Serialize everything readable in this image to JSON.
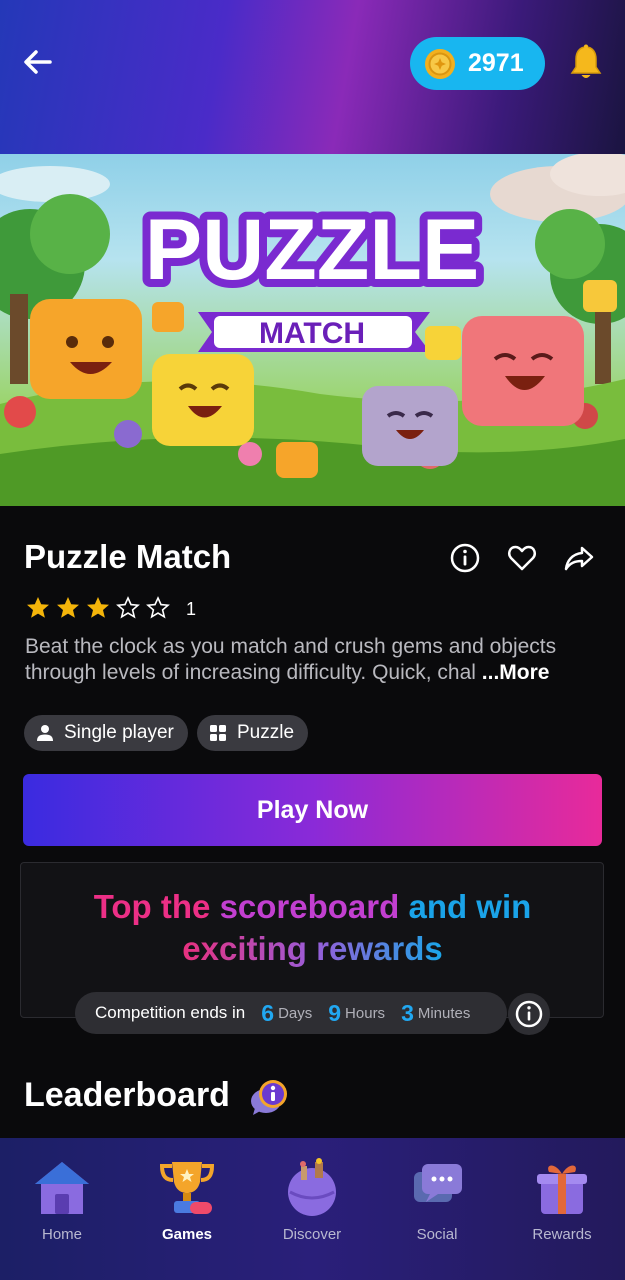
{
  "header": {
    "coins": "2971"
  },
  "game": {
    "title": "Puzzle Match",
    "rating": 3,
    "rating_max": 5,
    "rating_count": "1",
    "description": "Beat the clock as you match and crush gems and objects through levels of increasing difficulty. Quick, chal",
    "more_label": "...More",
    "tags": [
      "Single player",
      "Puzzle"
    ],
    "play_label": "Play Now",
    "hero_logo_top": "PUZZLE",
    "hero_logo_bottom": "MATCH"
  },
  "promo": {
    "line1_a": "Top the ",
    "line1_b": "scoreboard",
    "line1_c": " and win",
    "line2": "exciting rewards",
    "countdown_label": "Competition ends in",
    "days": "6",
    "days_unit": "Days",
    "hours": "9",
    "hours_unit": "Hours",
    "minutes": "3",
    "minutes_unit": "Minutes"
  },
  "leaderboard": {
    "title": "Leaderboard"
  },
  "nav": {
    "items": [
      {
        "label": "Home",
        "icon": "home-icon"
      },
      {
        "label": "Games",
        "icon": "trophy-icon"
      },
      {
        "label": "Discover",
        "icon": "globe-icon"
      },
      {
        "label": "Social",
        "icon": "chat-icon"
      },
      {
        "label": "Rewards",
        "icon": "gift-icon"
      }
    ],
    "active": "Games"
  },
  "colors": {
    "accent_blue": "#18b6f0",
    "play_start": "#3a2be0",
    "play_end": "#e82a9a",
    "star": "#f5b50a",
    "nav_bg": "#1c1f66"
  }
}
